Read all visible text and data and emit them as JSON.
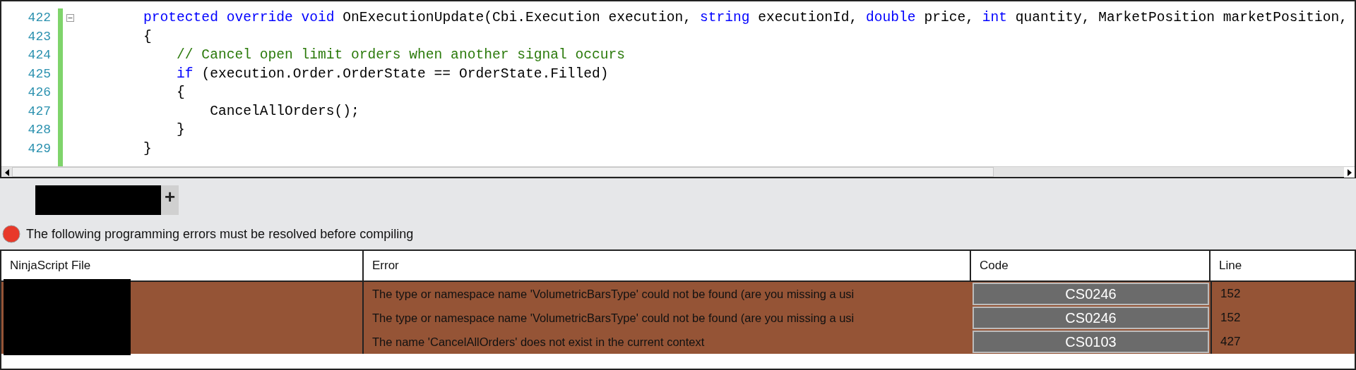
{
  "editor": {
    "lines": [
      {
        "number": "422",
        "fold": true,
        "tokens": [
          {
            "kind": "keyword",
            "text": "        protected "
          },
          {
            "kind": "keyword",
            "text": "override "
          },
          {
            "kind": "keyword",
            "text": "void"
          },
          {
            "kind": "plain",
            "text": " OnExecutionUpdate(Cbi.Execution execution, "
          },
          {
            "kind": "keyword",
            "text": "string"
          },
          {
            "kind": "plain",
            "text": " executionId, "
          },
          {
            "kind": "keyword",
            "text": "double"
          },
          {
            "kind": "plain",
            "text": " price, "
          },
          {
            "kind": "keyword",
            "text": "int"
          },
          {
            "kind": "plain",
            "text": " quantity, MarketPosition marketPosition,"
          }
        ]
      },
      {
        "number": "423",
        "fold": false,
        "tokens": [
          {
            "kind": "plain",
            "text": "        {"
          }
        ]
      },
      {
        "number": "424",
        "fold": false,
        "tokens": [
          {
            "kind": "comment",
            "text": "            // Cancel open limit orders when another signal occurs"
          }
        ]
      },
      {
        "number": "425",
        "fold": false,
        "tokens": [
          {
            "kind": "keyword",
            "text": "            if"
          },
          {
            "kind": "plain",
            "text": " (execution.Order.OrderState == OrderState.Filled)"
          }
        ]
      },
      {
        "number": "426",
        "fold": false,
        "tokens": [
          {
            "kind": "plain",
            "text": "            {"
          }
        ]
      },
      {
        "number": "427",
        "fold": false,
        "tokens": [
          {
            "kind": "plain",
            "text": "                CancelAllOrders();"
          }
        ]
      },
      {
        "number": "428",
        "fold": false,
        "tokens": [
          {
            "kind": "plain",
            "text": "            }"
          }
        ]
      },
      {
        "number": "429",
        "fold": false,
        "tokens": [
          {
            "kind": "plain",
            "text": "        }"
          }
        ]
      }
    ]
  },
  "tab_bar": {
    "tabs": [
      {
        "redacted": true
      }
    ],
    "add_button": "+"
  },
  "error_banner": {
    "message": "The following programming errors must be resolved before compiling"
  },
  "table": {
    "columns": [
      "NinjaScript File",
      "Error",
      "Code",
      "Line"
    ],
    "file_column_redacted": true,
    "rows": [
      {
        "error": "The type or namespace name 'VolumetricBarsType' could not be found (are you missing a usi",
        "code": "CS0246",
        "line": "152"
      },
      {
        "error": "The type or namespace name 'VolumetricBarsType' could not be found (are you missing a usi",
        "code": "CS0246",
        "line": "152"
      },
      {
        "error": "The name 'CancelAllOrders' does not exist in the current context",
        "code": "CS0103",
        "line": "427"
      }
    ]
  }
}
